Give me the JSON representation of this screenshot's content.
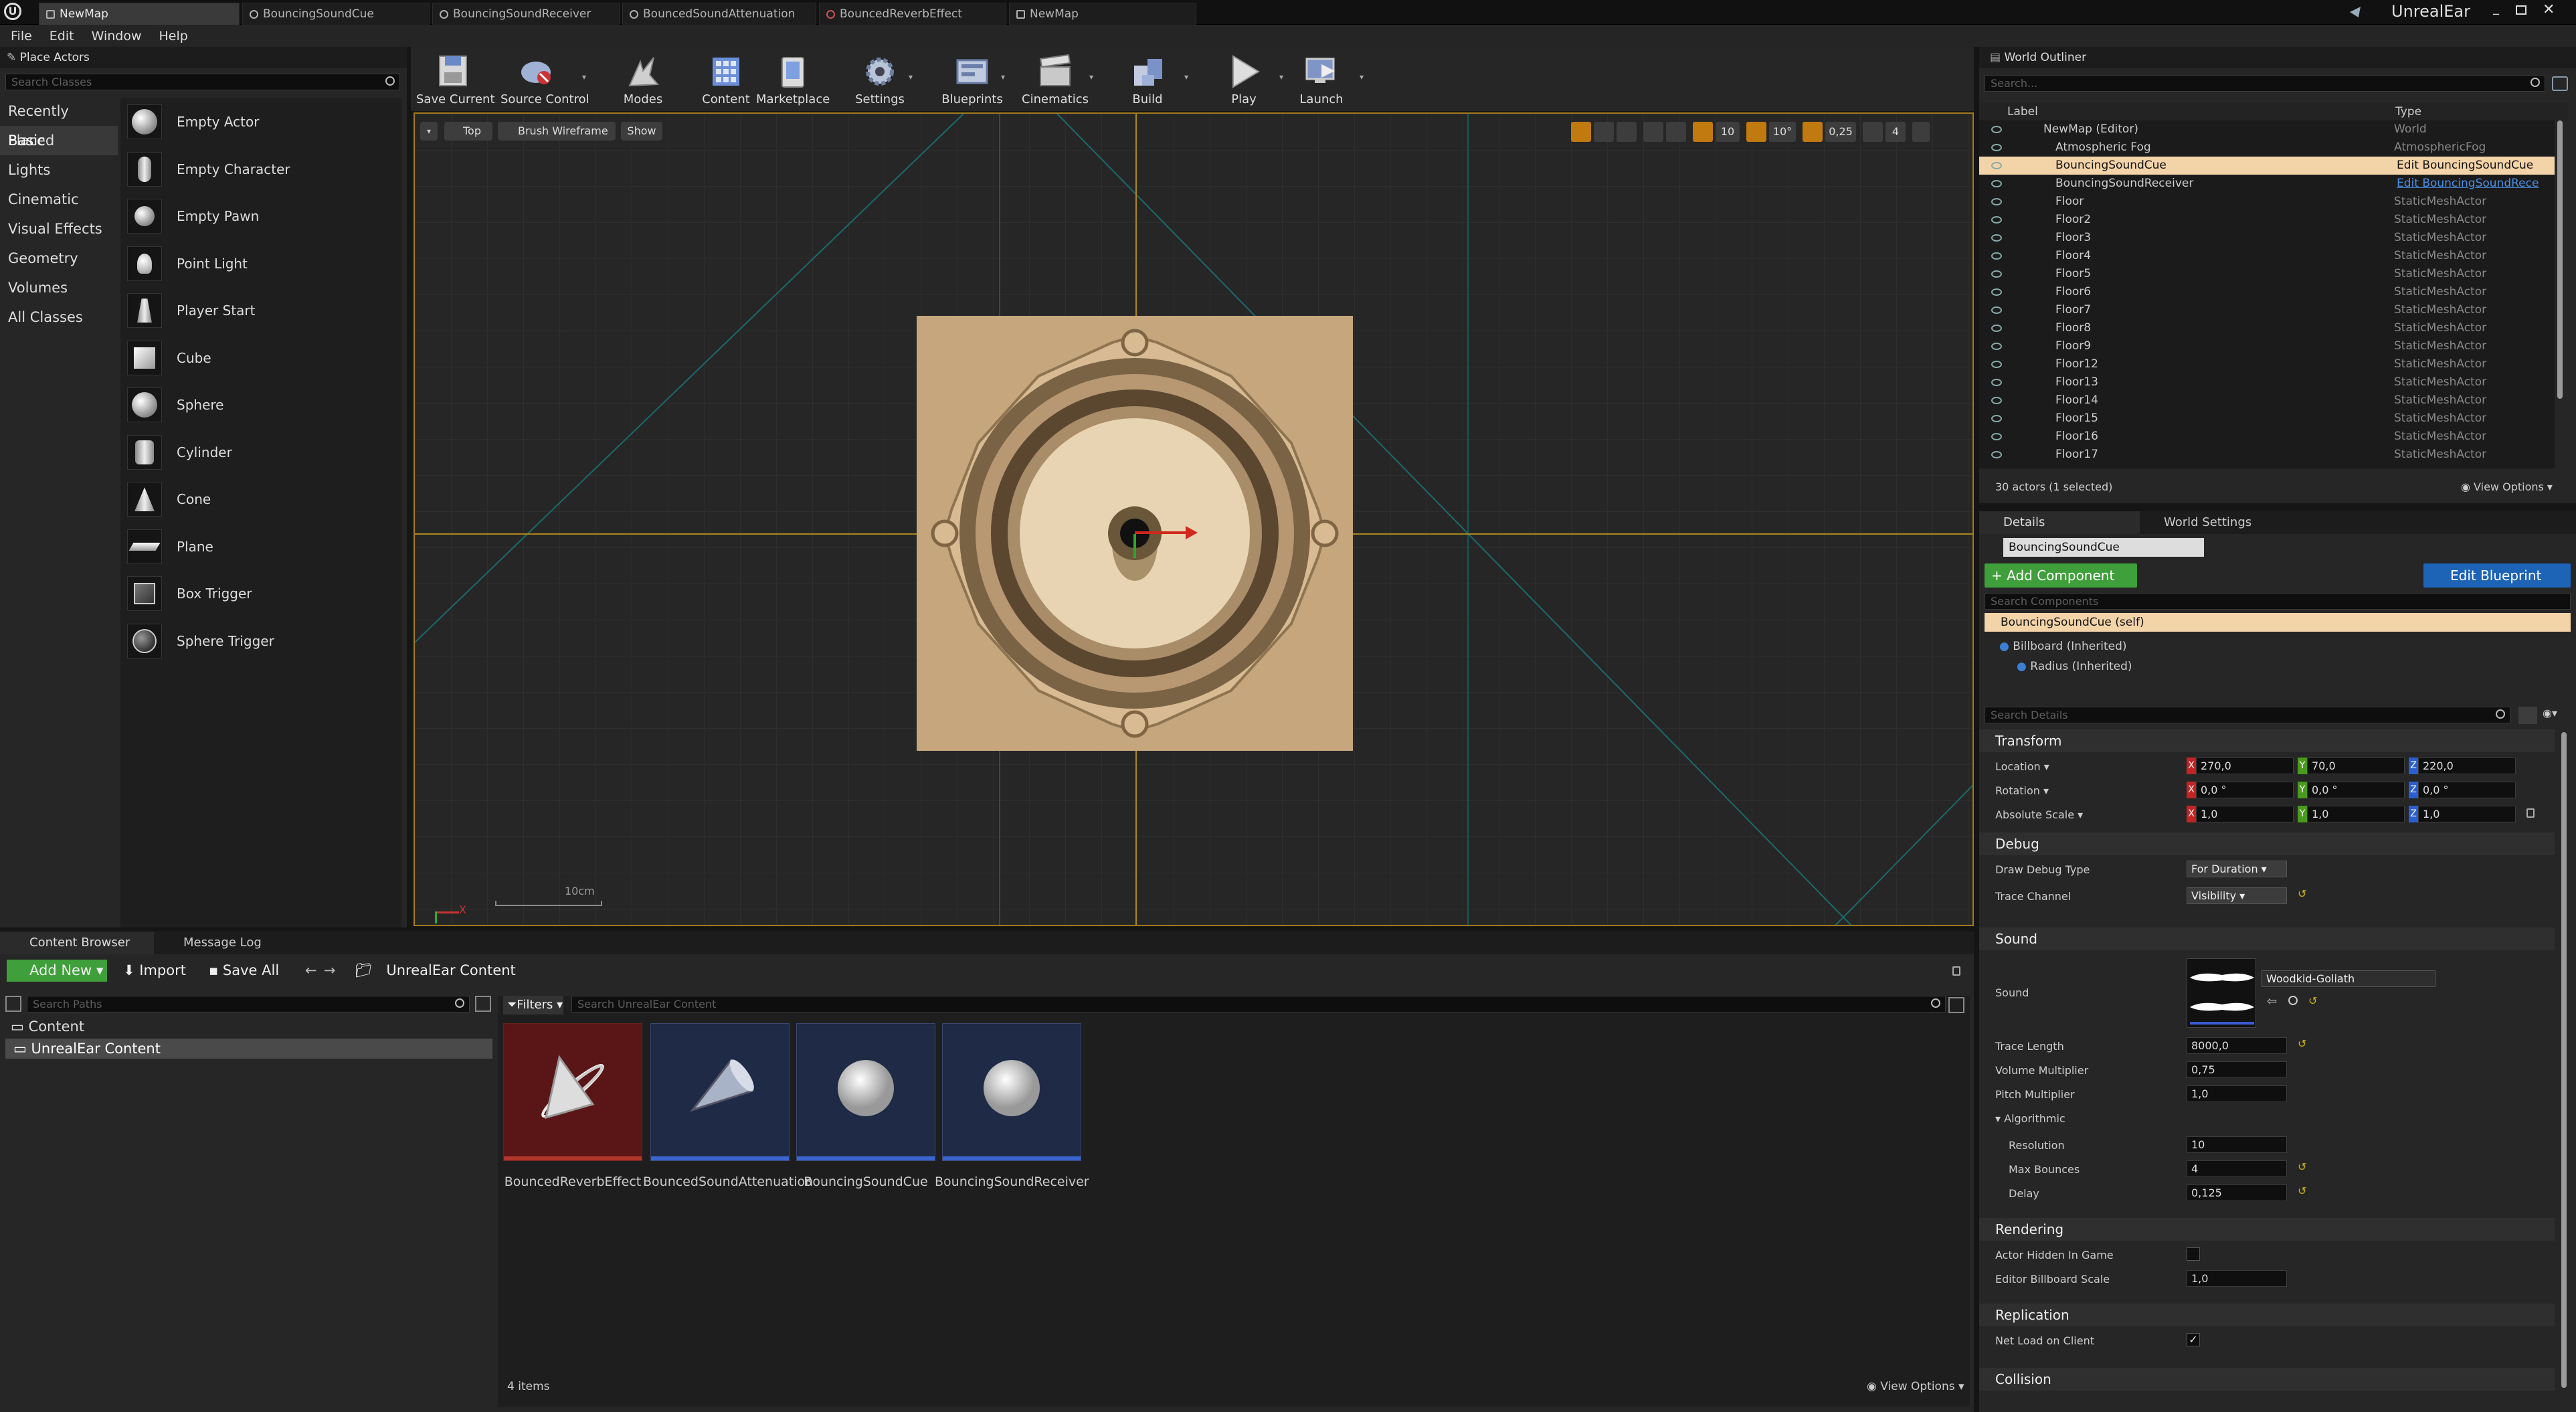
{
  "tabs": [
    {
      "label": "NewMap",
      "active": true
    },
    {
      "label": "BouncingSoundCue"
    },
    {
      "label": "BouncingSoundReceiver"
    },
    {
      "label": "BouncedSoundAttenuation"
    },
    {
      "label": "BouncedReverbEffect"
    },
    {
      "label": "NewMap"
    }
  ],
  "project_name": "UnrealEar",
  "menu": [
    "File",
    "Edit",
    "Window",
    "Help"
  ],
  "place_actors": {
    "title": "Place Actors",
    "search_placeholder": "Search Classes",
    "categories": [
      "Recently Placed",
      "Basic",
      "Lights",
      "Cinematic",
      "Visual Effects",
      "Geometry",
      "Volumes",
      "All Classes"
    ],
    "selected_category": "Basic",
    "actors": [
      "Empty Actor",
      "Empty Character",
      "Empty Pawn",
      "Point Light",
      "Player Start",
      "Cube",
      "Sphere",
      "Cylinder",
      "Cone",
      "Plane",
      "Box Trigger",
      "Sphere Trigger"
    ]
  },
  "toolbar": [
    {
      "label": "Save Current",
      "icon": "save-icon"
    },
    {
      "label": "Source Control",
      "icon": "source-control-icon"
    },
    {
      "label": "Modes",
      "icon": "modes-icon"
    },
    {
      "label": "Content",
      "icon": "content-icon"
    },
    {
      "label": "Marketplace",
      "icon": "marketplace-icon"
    },
    {
      "label": "Settings",
      "icon": "settings-icon"
    },
    {
      "label": "Blueprints",
      "icon": "blueprints-icon"
    },
    {
      "label": "Cinematics",
      "icon": "cinematics-icon"
    },
    {
      "label": "Build",
      "icon": "build-icon"
    },
    {
      "label": "Play",
      "icon": "play-icon"
    },
    {
      "label": "Launch",
      "icon": "launch-icon"
    }
  ],
  "viewport": {
    "view_label": "Top",
    "mode_label": "Brush Wireframe",
    "show_label": "Show",
    "grid_snap": "10",
    "rot_snap": "10°",
    "scale_snap": "0,25",
    "camera_speed": "4",
    "scale_bar": "10cm",
    "axis_x": "X"
  },
  "outliner": {
    "title": "World Outliner",
    "search_placeholder": "Search...",
    "col_label": "Label",
    "col_type": "Type",
    "rows": [
      {
        "label": "NewMap (Editor)",
        "type": "World"
      },
      {
        "label": "Atmospheric Fog",
        "type": "AtmosphericFog"
      },
      {
        "label": "BouncingSoundCue",
        "type": "Edit BouncingSoundCue",
        "selected": true
      },
      {
        "label": "BouncingSoundReceiver",
        "type": "Edit BouncingSoundRece",
        "link": true
      },
      {
        "label": "Floor",
        "type": "StaticMeshActor"
      },
      {
        "label": "Floor2",
        "type": "StaticMeshActor"
      },
      {
        "label": "Floor3",
        "type": "StaticMeshActor"
      },
      {
        "label": "Floor4",
        "type": "StaticMeshActor"
      },
      {
        "label": "Floor5",
        "type": "StaticMeshActor"
      },
      {
        "label": "Floor6",
        "type": "StaticMeshActor"
      },
      {
        "label": "Floor7",
        "type": "StaticMeshActor"
      },
      {
        "label": "Floor8",
        "type": "StaticMeshActor"
      },
      {
        "label": "Floor9",
        "type": "StaticMeshActor"
      },
      {
        "label": "Floor12",
        "type": "StaticMeshActor"
      },
      {
        "label": "Floor13",
        "type": "StaticMeshActor"
      },
      {
        "label": "Floor14",
        "type": "StaticMeshActor"
      },
      {
        "label": "Floor15",
        "type": "StaticMeshActor"
      },
      {
        "label": "Floor16",
        "type": "StaticMeshActor"
      },
      {
        "label": "Floor17",
        "type": "StaticMeshActor"
      }
    ],
    "status": "30 actors (1 selected)",
    "view_options": "View Options"
  },
  "details": {
    "tab_details": "Details",
    "tab_world": "World Settings",
    "actor_name": "BouncingSoundCue",
    "add_component": "+ Add Component",
    "edit_blueprint": "Edit Blueprint",
    "search_components": "Search Components",
    "self_component": "BouncingSoundCue (self)",
    "billboard": "Billboard (Inherited)",
    "radius": "Radius (Inherited)",
    "search_details": "Search Details",
    "transform": {
      "title": "Transform",
      "location_label": "Location",
      "location": [
        "270,0",
        "70,0",
        "220,0"
      ],
      "rotation_label": "Rotation",
      "rotation": [
        "0,0 °",
        "0,0 °",
        "0,0 °"
      ],
      "scale_label": "Absolute Scale",
      "scale": [
        "1,0",
        "1,0",
        "1,0"
      ]
    },
    "debug": {
      "title": "Debug",
      "draw_type_label": "Draw Debug Type",
      "draw_type": "For Duration",
      "trace_channel_label": "Trace Channel",
      "trace_channel": "Visibility"
    },
    "sound": {
      "title": "Sound",
      "sound_label": "Sound",
      "sound_asset": "Woodkid-Goliath",
      "trace_length_label": "Trace Length",
      "trace_length": "8000,0",
      "volume_label": "Volume Multiplier",
      "volume": "0,75",
      "pitch_label": "Pitch Multiplier",
      "pitch": "1,0",
      "algorithmic": "Algorithmic",
      "resolution_label": "Resolution",
      "resolution": "10",
      "max_bounces_label": "Max Bounces",
      "max_bounces": "4",
      "delay_label": "Delay",
      "delay": "0,125"
    },
    "rendering": {
      "title": "Rendering",
      "hidden_label": "Actor Hidden In Game",
      "hidden": false,
      "billboard_scale_label": "Editor Billboard Scale",
      "billboard_scale": "1,0"
    },
    "replication": {
      "title": "Replication",
      "net_load_label": "Net Load on Client",
      "net_load": true
    },
    "collision_title": "Collision"
  },
  "content_browser": {
    "tab_content": "Content Browser",
    "tab_log": "Message Log",
    "add_new": "Add New",
    "import": "Import",
    "save_all": "Save All",
    "path": "UnrealEar Content",
    "search_paths": "Search Paths",
    "folders": [
      "Content",
      "UnrealEar Content"
    ],
    "filters": "Filters",
    "search_content": "Search UnrealEar Content",
    "assets": [
      {
        "name": "BouncedReverbEffect",
        "bar": "#b0352b"
      },
      {
        "name": "BouncedSoundAttenuation",
        "bar": "#3a64d0"
      },
      {
        "name": "BouncingSoundCue",
        "bar": "#3a64d0"
      },
      {
        "name": "BouncingSoundReceiver",
        "bar": "#3a64d0"
      }
    ],
    "item_count": "4 items",
    "view_options": "View Options"
  }
}
